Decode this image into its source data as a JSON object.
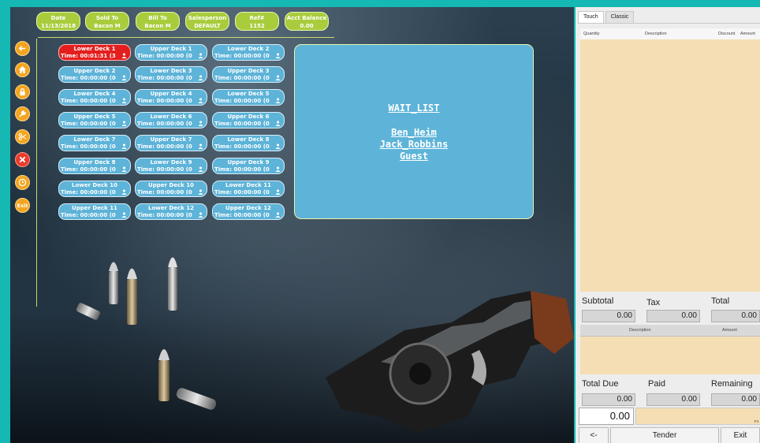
{
  "colors": {
    "header_pill": "#a8cc3c",
    "table_button": "#5db3d8",
    "table_active": "#e41e1e",
    "side_button": "#f3a521",
    "side_button_close": "#ea3c2c",
    "order_area": "#f5deb3",
    "page_background": "#15b8b2"
  },
  "header": [
    {
      "label": "Date",
      "value": "11/13/2018"
    },
    {
      "label": "Sold To",
      "value": "Bacon M"
    },
    {
      "label": "Bill To",
      "value": "Bacon M"
    },
    {
      "label": "Salesperson",
      "value": "DEFAULT"
    },
    {
      "label": "Ref#",
      "value": "1152"
    },
    {
      "label": "Acct Balance",
      "value": "0.00"
    }
  ],
  "side_buttons": [
    {
      "icon": "back-arrow-icon"
    },
    {
      "icon": "home-icon"
    },
    {
      "icon": "lock-icon"
    },
    {
      "icon": "wrench-icon"
    },
    {
      "icon": "scissors-icon"
    },
    {
      "icon": "close-icon"
    },
    {
      "icon": "clock-icon"
    },
    {
      "icon": "exit-icon",
      "label": "Exit"
    }
  ],
  "tables": [
    {
      "name": "Lower Deck 1",
      "time": "Time: 00:01:31 (3",
      "active": true
    },
    {
      "name": "Upper Deck 1",
      "time": "Time: 00:00:00 (0"
    },
    {
      "name": "Lower Deck 2",
      "time": "Time: 00:00:00 (0"
    },
    {
      "name": "Upper Deck 2",
      "time": "Time: 00:00:00 (0"
    },
    {
      "name": "Lower Deck 3",
      "time": "Time: 00:00:00 (0"
    },
    {
      "name": "Upper Deck 3",
      "time": "Time: 00:00:00 (0"
    },
    {
      "name": "Lower Deck 4",
      "time": "Time: 00:00:00 (0"
    },
    {
      "name": "Upper Deck 4",
      "time": "Time: 00:00:00 (0"
    },
    {
      "name": "Lower Deck 5",
      "time": "Time: 00:00:00 (0"
    },
    {
      "name": "Upper Deck 5",
      "time": "Time: 00:00:00 (0"
    },
    {
      "name": "Lower Deck 6",
      "time": "Time: 00:00:00 (0"
    },
    {
      "name": "Upper Deck 6",
      "time": "Time: 00:00:00 (0"
    },
    {
      "name": "Lower Deck 7",
      "time": "Time: 00:00:00 (0"
    },
    {
      "name": "Upper Deck 7",
      "time": "Time: 00:00:00 (0"
    },
    {
      "name": "Lower Deck 8",
      "time": "Time: 00:00:00 (0"
    },
    {
      "name": "Upper Deck 8",
      "time": "Time: 00:00:00 (0"
    },
    {
      "name": "Lower Deck 9",
      "time": "Time: 00:00:00 (0"
    },
    {
      "name": "Upper Deck 9",
      "time": "Time: 00:00:00 (0"
    },
    {
      "name": "Lower Deck 10",
      "time": "Time: 00:00:00 (0"
    },
    {
      "name": "Upper Deck 10",
      "time": "Time: 00:00:00 (0"
    },
    {
      "name": "Lower Deck 11",
      "time": "Time: 00:00:00 (0"
    },
    {
      "name": "Upper Deck 11",
      "time": "Time: 00:00:00 (0"
    },
    {
      "name": "Lower Deck 12",
      "time": "Time: 00:00:00 (0"
    },
    {
      "name": "Upper Deck 12",
      "time": "Time: 00:00:00 (0"
    }
  ],
  "waitlist": {
    "title": "WAIT_LIST",
    "names": [
      "Ben_Heim",
      "Jack_Robbins",
      "Guest"
    ]
  },
  "pos": {
    "tabs": [
      "Touch",
      "Classic"
    ],
    "order_columns": [
      "Quantity",
      "Description",
      "Discount",
      "Amount"
    ],
    "subtotal_label": "Subtotal",
    "tax_label": "Tax",
    "total_label": "Total",
    "subtotal": "0.00",
    "tax": "0.00",
    "total": "0.00",
    "tender_columns": [
      "Description",
      "Amount"
    ],
    "total_due_label": "Total Due",
    "paid_label": "Paid",
    "remaining_label": "Remaining",
    "total_due": "0.00",
    "paid": "0.00",
    "remaining": "0.00",
    "entry_value": "0.00",
    "entry_hint": "F4",
    "back_button": "<-",
    "tender_button": "Tender",
    "exit_button": "Exit"
  }
}
